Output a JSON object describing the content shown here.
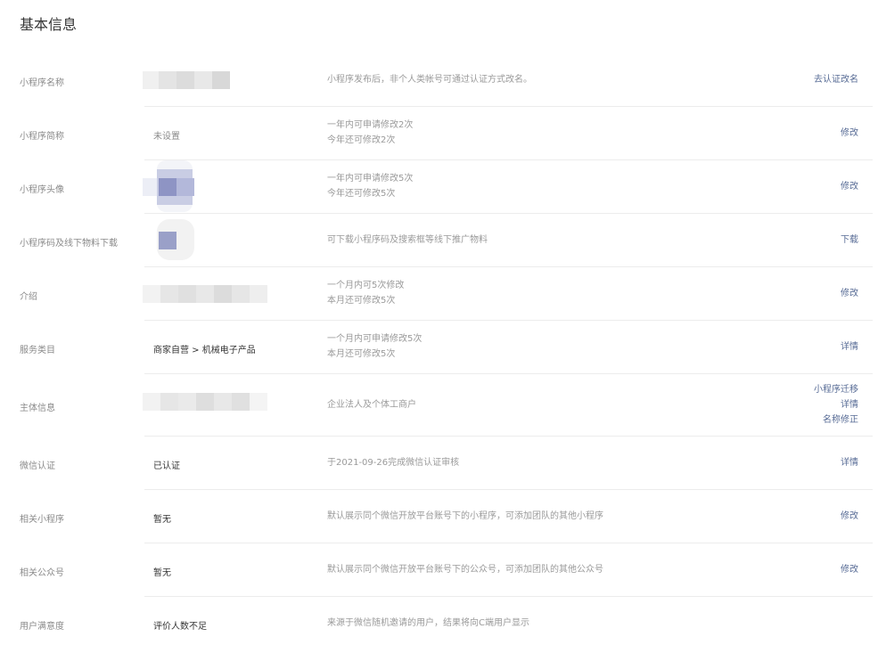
{
  "page": {
    "title": "基本信息"
  },
  "rows": [
    {
      "label": "小程序名称",
      "value": "",
      "desc1": "小程序发布后，非个人类帐号可通过认证方式改名。",
      "desc2": "",
      "actions": [
        "去认证改名"
      ]
    },
    {
      "label": "小程序简称",
      "value": "未设置",
      "desc1": "一年内可申请修改2次",
      "desc2": "今年还可修改2次",
      "actions": [
        "修改"
      ]
    },
    {
      "label": "小程序头像",
      "value": "",
      "desc1": "一年内可申请修改5次",
      "desc2": "今年还可修改5次",
      "actions": [
        "修改"
      ]
    },
    {
      "label": "小程序码及线下物料下载",
      "value": "",
      "desc1": "可下载小程序码及搜索框等线下推广物料",
      "desc2": "",
      "actions": [
        "下载"
      ]
    },
    {
      "label": "介绍",
      "value": "",
      "desc1": "一个月内可5次修改",
      "desc2": "本月还可修改5次",
      "actions": [
        "修改"
      ]
    },
    {
      "label": "服务类目",
      "value": "商家自营 > 机械电子产品",
      "desc1": "一个月内可申请修改5次",
      "desc2": "本月还可修改5次",
      "actions": [
        "详情"
      ]
    },
    {
      "label": "主体信息",
      "value": "",
      "desc1": "企业法人及个体工商户",
      "desc2": "",
      "actions": [
        "小程序迁移",
        "详情",
        "名称修正"
      ]
    },
    {
      "label": "微信认证",
      "value": "已认证",
      "desc1": "于2021-09-26完成微信认证审核",
      "desc2": "",
      "actions": [
        "详情"
      ]
    },
    {
      "label": "相关小程序",
      "value": "暂无",
      "desc1": "默认展示同个微信开放平台账号下的小程序，可添加团队的其他小程序",
      "desc2": "",
      "actions": [
        "修改"
      ]
    },
    {
      "label": "相关公众号",
      "value": "暂无",
      "desc1": "默认展示同个微信开放平台账号下的公众号，可添加团队的其他公众号",
      "desc2": "",
      "actions": [
        "修改"
      ]
    },
    {
      "label": "用户满意度",
      "value": "评价人数不足",
      "desc1": "来源于微信随机邀请的用户，结果将向C端用户显示",
      "desc2": "",
      "actions": []
    }
  ],
  "colors": {
    "link": "#576b95",
    "label": "#8a8a8a",
    "divider": "#ececec"
  }
}
